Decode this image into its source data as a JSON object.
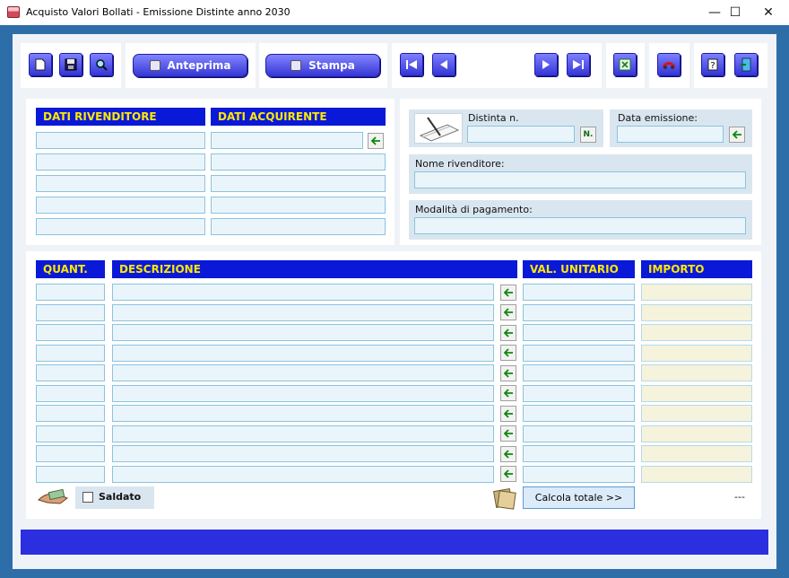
{
  "window": {
    "title": "Acquisto Valori Bollati - Emissione Distinte anno 2030",
    "controls": {
      "minimize": "—",
      "maximize": "☐",
      "close": "✕"
    }
  },
  "toolbar": {
    "new_icon": "new-document-icon",
    "save_icon": "floppy-disk-icon",
    "search_icon": "magnifier-icon",
    "preview_label": "Anteprima",
    "print_label": "Stampa",
    "first_icon": "first-record-icon",
    "prev_icon": "previous-record-icon",
    "next_icon": "next-record-icon",
    "last_icon": "last-record-icon",
    "excel_icon": "excel-export-icon",
    "tools_icon": "tools-icon",
    "help_icon": "help-icon",
    "exit_icon": "exit-door-icon"
  },
  "parties": {
    "seller_header": "DATI RIVENDITORE",
    "buyer_header": "DATI ACQUIRENTE",
    "seller_lines": [
      "",
      "",
      "",
      "",
      ""
    ],
    "buyer_lines": [
      "",
      "",
      "",
      "",
      ""
    ]
  },
  "invoice": {
    "number_label": "Distinta n.",
    "number_value": "",
    "new_number_button": "N.",
    "date_label": "Data emissione:",
    "date_value": "",
    "seller_name_label": "Nome rivenditore:",
    "seller_name_value": "",
    "payment_label": "Modalità di pagamento:",
    "payment_value": ""
  },
  "items": {
    "qty_header": "QUANT.",
    "desc_header": "DESCRIZIONE",
    "unit_header": "VAL. UNITARIO",
    "amount_header": "IMPORTO",
    "rows": [
      {
        "qty": "",
        "desc": "",
        "unit": "",
        "amount": ""
      },
      {
        "qty": "",
        "desc": "",
        "unit": "",
        "amount": ""
      },
      {
        "qty": "",
        "desc": "",
        "unit": "",
        "amount": ""
      },
      {
        "qty": "",
        "desc": "",
        "unit": "",
        "amount": ""
      },
      {
        "qty": "",
        "desc": "",
        "unit": "",
        "amount": ""
      },
      {
        "qty": "",
        "desc": "",
        "unit": "",
        "amount": ""
      },
      {
        "qty": "",
        "desc": "",
        "unit": "",
        "amount": ""
      },
      {
        "qty": "",
        "desc": "",
        "unit": "",
        "amount": ""
      },
      {
        "qty": "",
        "desc": "",
        "unit": "",
        "amount": ""
      },
      {
        "qty": "",
        "desc": "",
        "unit": "",
        "amount": ""
      }
    ]
  },
  "footer": {
    "paid_label": "Saldato",
    "calc_button": "Calcola totale  >>",
    "total_value": "---"
  },
  "colors": {
    "frame": "#2e6ea8",
    "header_bg": "#0a19d8",
    "header_text": "#ffe800",
    "field_bg": "#e9f5fb",
    "amount_bg": "#f5f3dc",
    "status_bar": "#2b2fe0"
  }
}
